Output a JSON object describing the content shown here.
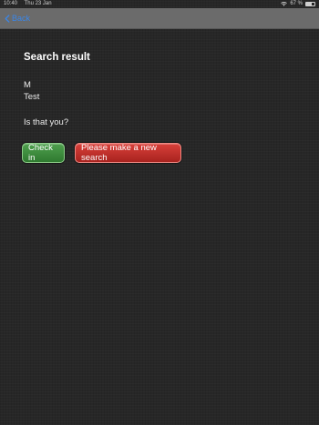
{
  "status_bar": {
    "time": "10:40",
    "date": "Thu 23 Jan",
    "battery_text": "67 %",
    "battery_level": 0.67
  },
  "nav": {
    "back_label": "Back"
  },
  "main": {
    "title": "Search result",
    "first_name": "M",
    "last_name": "Test",
    "question": "Is that you?"
  },
  "actions": {
    "check_in_label": "Check in",
    "new_search_label": "Please make a new search"
  },
  "colors": {
    "accent": "#3a86e8",
    "confirm": "#3a8a3a",
    "cancel": "#c0302b"
  }
}
